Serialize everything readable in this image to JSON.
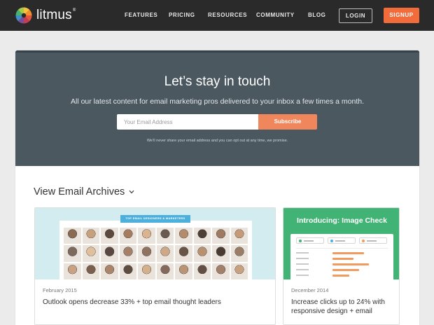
{
  "nav": {
    "logo_text": "litmus",
    "logo_reg": "®",
    "items": [
      "FEATURES",
      "PRICING",
      "RESOURCES",
      "COMMUNITY",
      "BLOG"
    ],
    "login_label": "LOGIN",
    "signup_label": "SIGNUP"
  },
  "hero": {
    "title": "Let’s stay in touch",
    "subtitle": "All our latest content for email marketing pros delivered to your inbox a few times a month.",
    "email_placeholder": "Your Email Address",
    "subscribe_label": "Subscribe",
    "note": "We’ll never share your email address and you can opt out at any time, we promise."
  },
  "archives": {
    "title": "View Email Archives",
    "articles": [
      {
        "date": "February 2015",
        "title": "Outlook opens decrease 33% + top email thought leaders",
        "image_tag": "TOP EMAIL DESIGNERS & MARKETERS"
      },
      {
        "date": "December 2014",
        "title": "Increase clicks up to 24% with responsive design + email",
        "image_title": "Introducing: Image Check"
      }
    ]
  },
  "colors": {
    "nav_bg": "#2a2a2a",
    "hero_bg": "#4b5860",
    "accent_orange": "#f26b3a",
    "subscribe_orange": "#f0865c",
    "image_check_green": "#41b374",
    "collage_bg": "#d2ecef",
    "collage_tag_blue": "#4db0dc"
  },
  "icons": {
    "logo": "litmus-logo-icon",
    "archives_toggle": "chevron-down-icon"
  }
}
